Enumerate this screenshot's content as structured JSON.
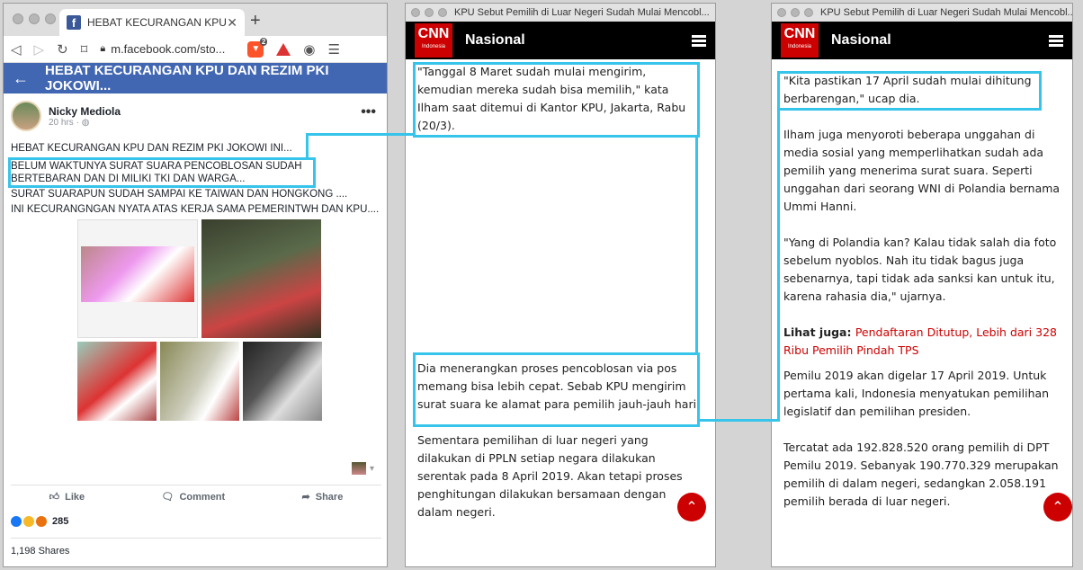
{
  "facebook": {
    "tab_title": "HEBAT KECURANGAN KPU DAN",
    "url": "m.facebook.com/sto...",
    "brave_count": "2",
    "header_title": "HEBAT KECURANGAN KPU DAN REZIM PKI JOKOWI...",
    "author": "Nicky Mediola",
    "time": "20 hrs",
    "post_lines": [
      "HEBAT KECURANGAN KPU DAN REZIM PKI JOKOWI INI...",
      "BELUM WAKTUNYA SURAT SUARA PENCOBLOSAN SUDAH BERTEBARAN DAN DI MILIKI TKI DAN WARGA...",
      "SURAT SUARAPUN SUDAH SAMPAI KE TAIWAN DAN HONGKONG ....",
      "INI KECURANGNGAN NYATA ATAS KERJA SAMA PEMERINTWH DAN KPU...."
    ],
    "like": "Like",
    "comment": "Comment",
    "share": "Share",
    "reactions": "285",
    "shares": "1,198 Shares"
  },
  "cnn": {
    "window_title": "KPU Sebut Pemilih di Luar Negeri Sudah Mulai Mencobl...",
    "logo": "CNN",
    "logo_sub": "Indonesia",
    "section": "Nasional",
    "left_paras": [
      "\"Tanggal 8 Maret sudah mulai mengirim, kemudian mereka sudah bisa memilih,\" kata Ilham saat ditemui di Kantor KPU, Jakarta, Rabu (20/3).",
      "Dia menerangkan proses pencoblosan via pos memang bisa lebih cepat. Sebab KPU mengirim surat suara ke alamat para pemilih jauh-jauh hari.",
      "Sementara pemilihan di luar negeri yang dilakukan di PPLN setiap negara dilakukan serentak pada 8 April 2019. Akan tetapi proses penghitungan dilakukan bersamaan dengan dalam negeri."
    ],
    "right_paras": [
      "\"Kita pastikan 17 April sudah mulai dihitung berbarengan,\" ucap dia.",
      "Ilham juga menyoroti beberapa unggahan di media sosial yang memperlihatkan sudah ada pemilih yang menerima surat suara. Seperti unggahan dari seorang WNI di Polandia bernama Ummi Hanni.",
      "\"Yang di Polandia kan? Kalau tidak salah dia foto sebelum nyoblos. Nah itu tidak bagus juga sebenarnya, tapi tidak ada sanksi kan untuk itu, karena rahasia dia,\" ujarnya.",
      "Pemilu 2019 akan digelar 17 April 2019. Untuk pertama kali, Indonesia menyatukan pemilihan legislatif dan pemilihan presiden.",
      "Tercatat ada 192.828.520 orang pemilih di DPT Pemilu 2019. Sebanyak 190.770.329 merupakan pemilih di dalam negeri, sedangkan 2.058.191 pemilih berada di luar negeri."
    ],
    "lihat_label": "Lihat juga:",
    "lihat_link": "Pendaftaran Ditutup, Lebih dari 328 Ribu Pemilih Pindah TPS"
  },
  "colors": {
    "highlight": "#36c4ea",
    "cnn_red": "#cc0000",
    "fb_blue": "#4267b2"
  }
}
